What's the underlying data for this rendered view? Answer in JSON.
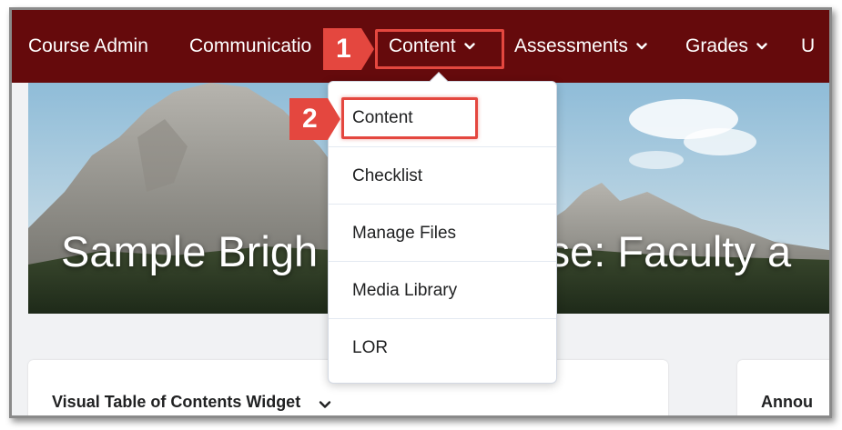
{
  "navbar": {
    "items": [
      {
        "label": "Course Admin",
        "has_menu": false
      },
      {
        "label": "Communicatio",
        "has_menu": false
      },
      {
        "label": "Content",
        "has_menu": true
      },
      {
        "label": "Assessments",
        "has_menu": true
      },
      {
        "label": "Grades",
        "has_menu": true
      },
      {
        "label": "U",
        "has_menu": false
      }
    ],
    "background": "#650a0c"
  },
  "banner": {
    "title": "Sample Brigh"
  },
  "banner_title_right": "rse: Faculty a",
  "dropdown": {
    "items": [
      {
        "label": "Content"
      },
      {
        "label": "Checklist"
      },
      {
        "label": "Manage Files"
      },
      {
        "label": "Media Library"
      },
      {
        "label": "LOR"
      }
    ]
  },
  "widgets": {
    "left_title": "Visual Table of Contents Widget",
    "right_title": "Annou"
  },
  "callouts": {
    "step1": "1",
    "step2": "2",
    "color": "#e4473f"
  },
  "icons": {
    "nav_chevron": "chevron-down-icon",
    "widget_chevron": "chevron-down-icon"
  }
}
